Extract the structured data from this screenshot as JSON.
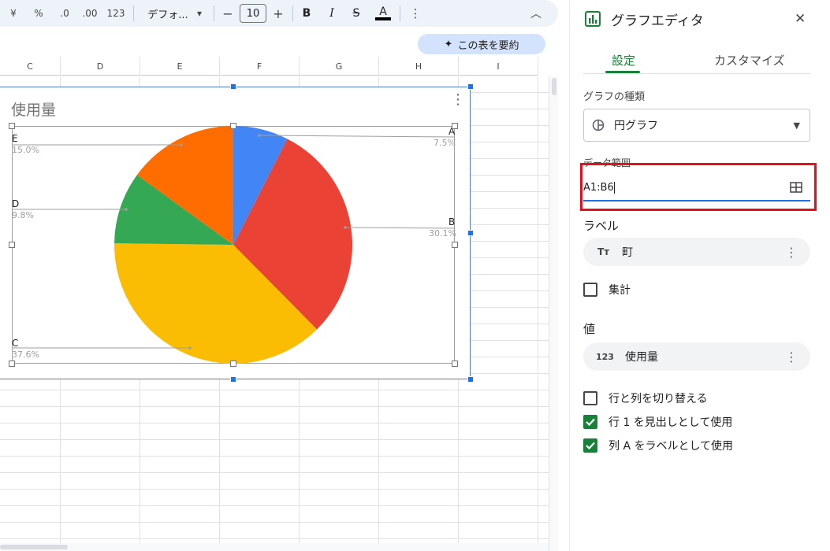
{
  "toolbar": {
    "currency": "¥",
    "percent": "%",
    "dec_decrease": ".0",
    "dec_increase": ".00",
    "number_format": "123",
    "font": "デフォ...",
    "font_size": "10",
    "minus": "−",
    "plus": "+",
    "bold": "B",
    "italic": "I",
    "strike": "S",
    "text_color": "A",
    "more": "⋮",
    "collapse": "︿"
  },
  "summary_button": {
    "label": "この表を要約",
    "icon": "sparkle-icon"
  },
  "columns": [
    "C",
    "D",
    "E",
    "F",
    "G",
    "H",
    "I"
  ],
  "chart": {
    "title": "使用量",
    "slices": [
      {
        "label": "A",
        "pct": "7.5%",
        "value": 7.5,
        "color": "#4285f4"
      },
      {
        "label": "B",
        "pct": "30.1%",
        "value": 30.1,
        "color": "#ea4335"
      },
      {
        "label": "C",
        "pct": "37.6%",
        "value": 37.6,
        "color": "#fbbc04"
      },
      {
        "label": "D",
        "pct": "9.8%",
        "value": 9.8,
        "color": "#34a853"
      },
      {
        "label": "E",
        "pct": "15.0%",
        "value": 15.0,
        "color": "#ff6d01"
      }
    ]
  },
  "chart_data": {
    "type": "pie",
    "title": "使用量",
    "categories": [
      "A",
      "B",
      "C",
      "D",
      "E"
    ],
    "values": [
      7.5,
      30.1,
      37.6,
      9.8,
      15.0
    ],
    "legend": "labels"
  },
  "panel": {
    "title": "グラフエディタ",
    "close": "✕",
    "tabs": [
      "設定",
      "カスタマイズ"
    ],
    "chart_type_label": "グラフの種類",
    "chart_type_value": "円グラフ",
    "data_range_label": "データ範囲",
    "data_range_value": "A1:B6",
    "label_section": "ラベル",
    "label_value": "町",
    "aggregate": "集計",
    "values_section": "値",
    "values_value": "使用量",
    "switch_rows_cols": "行と列を切り替える",
    "row1_header": "行 1 を見出しとして使用",
    "colA_labels": "列 A をラベルとして使用"
  },
  "colors": {
    "accent_green": "#188038",
    "highlight_red": "#e0111d",
    "focus_blue": "#1a73e8"
  }
}
